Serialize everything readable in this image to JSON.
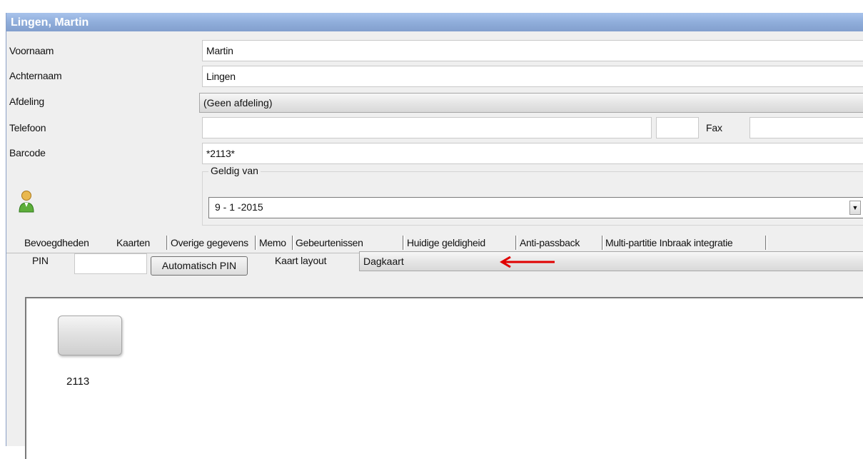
{
  "window": {
    "title": "Lingen, Martin"
  },
  "form": {
    "voornaam": {
      "label": "Voornaam",
      "value": "Martin"
    },
    "achternaam": {
      "label": "Achternaam",
      "value": "Lingen"
    },
    "afdeling": {
      "label": "Afdeling",
      "value": "(Geen afdeling)"
    },
    "telefoon": {
      "label": "Telefoon",
      "value": "",
      "value2": ""
    },
    "fax": {
      "label": "Fax",
      "value": ""
    },
    "barcode": {
      "label": "Barcode",
      "value": "*2113*"
    },
    "geldig_van": {
      "label": "Geldig van",
      "value": "9 - 1 -2015"
    }
  },
  "tabs": [
    {
      "label": "Bevoegdheden"
    },
    {
      "label": "Kaarten",
      "active": true
    },
    {
      "label": "Overige gegevens"
    },
    {
      "label": "Memo"
    },
    {
      "label": "Gebeurtenissen"
    },
    {
      "label": "Huidige geldigheid"
    },
    {
      "label": "Anti-passback"
    },
    {
      "label": "Multi-partitie Inbraak integratie"
    }
  ],
  "kaarten": {
    "pin_label": "PIN",
    "pin_value": "",
    "auto_pin_button": "Automatisch PIN",
    "layout_label": "Kaart layout",
    "layout_value": "Dagkaart",
    "cards": [
      {
        "number": "2113"
      }
    ]
  },
  "colors": {
    "title_bar": "#90aedb",
    "annotation_arrow": "#e00000"
  },
  "icons": {
    "person": "user-icon",
    "annotation": "red-arrow-icon"
  }
}
